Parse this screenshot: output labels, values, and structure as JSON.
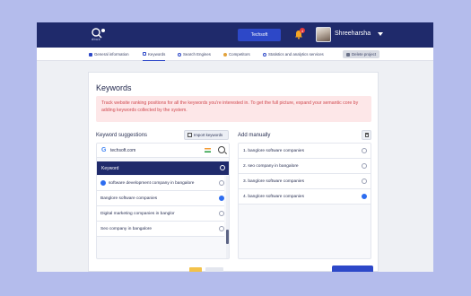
{
  "header": {
    "logo_text": "dbuk",
    "company_button": "Techsoft",
    "notification_count": "4",
    "username": "Shreeharsha"
  },
  "nav": {
    "items": [
      {
        "label": "General information",
        "icon": "info-icon",
        "color": "#2d48c8"
      },
      {
        "label": "Keywords",
        "icon": "chart-icon",
        "color": "#2d48c8"
      },
      {
        "label": "Search Engines",
        "icon": "search-icon",
        "color": "#2d48c8"
      },
      {
        "label": "Competitors",
        "icon": "competitors-icon",
        "color": "#e2a23b"
      },
      {
        "label": "Statistics and analytics services",
        "icon": "settings-icon",
        "color": "#2d48c8"
      }
    ],
    "delete_label": "Delete project",
    "active": "Keywords"
  },
  "main": {
    "title": "Keywords",
    "alert": "Track website ranking positions for all the keywords you're interested in. To get the full picture, expand your semantic core by adding keywords collected by the system.",
    "suggestions": {
      "title": "Keyword suggestions",
      "import_label": "Import keywords",
      "domain": "techsoft.com",
      "header": "Keyword",
      "rows": [
        {
          "text": "software development company in bangalore",
          "checked": true
        },
        {
          "text": "Banglore software companies",
          "checked": true
        },
        {
          "text": "Digital marketing companies in banglor",
          "checked": false
        },
        {
          "text": "Seo company in bangalore",
          "checked": false
        }
      ]
    },
    "manual": {
      "title": "Add manually",
      "rows": [
        {
          "text": "1. banglore software companies",
          "checked": false
        },
        {
          "text": "2. seo company in bangalore",
          "checked": false
        },
        {
          "text": "3. banglore software companies",
          "checked": false
        },
        {
          "text": "4. banglore software companies",
          "checked": true
        }
      ]
    }
  },
  "colors": {
    "brand": "#1f2a6b",
    "accent": "#2d48c8",
    "alert_bg": "#fde7e8",
    "alert_text": "#d04a50"
  }
}
